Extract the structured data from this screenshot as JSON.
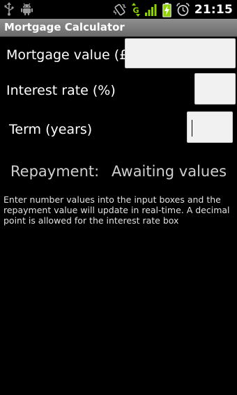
{
  "status_bar": {
    "left_icons": [
      "usb-icon",
      "android-debug-icon"
    ],
    "right_icons": [
      "vibrate-icon",
      "network-g-icon",
      "signal-icon",
      "battery-charging-icon",
      "alarm-icon"
    ],
    "network_letter": "G",
    "time": "21:15"
  },
  "app": {
    "title": "Mortgage Calculator"
  },
  "form": {
    "mortgage_label": "Mortgage value (£)",
    "mortgage_value": "",
    "interest_label": "Interest rate (%)",
    "interest_value": "",
    "term_label": "Term (years)",
    "term_value": ""
  },
  "result": {
    "label": "Repayment:",
    "value": "Awaiting values"
  },
  "help": {
    "text": "Enter number values into the input boxes and the repayment value will update in real-time. A decimal point is allowed for the interest rate box"
  },
  "colors": {
    "background": "#000000",
    "titlebar": "#7d7d7d",
    "accent_green": "#8fd400",
    "input_bg": "#f1f1f1"
  }
}
